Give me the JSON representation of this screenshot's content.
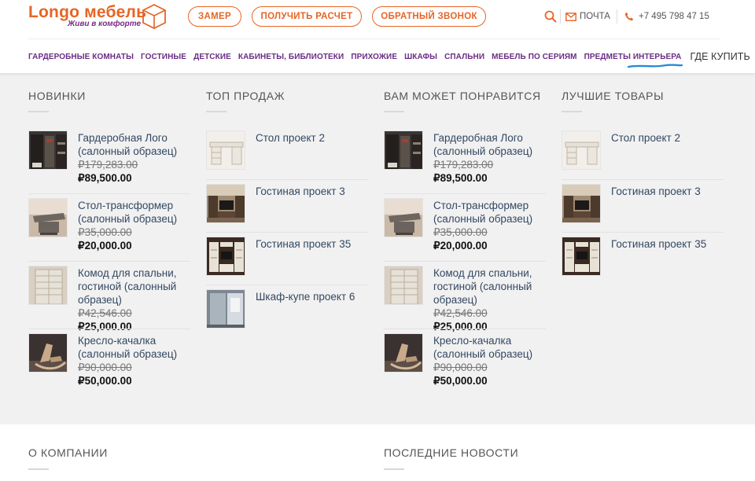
{
  "brand": {
    "name": "Longo мебель",
    "tagline": "Живи в комфорте",
    "accent_color": "#e86424",
    "secondary_color": "#7a2a85"
  },
  "header": {
    "buttons": [
      "ЗАМЕР",
      "ПОЛУЧИТЬ РАСЧЕТ",
      "ОБРАТНЫЙ ЗВОНОК"
    ],
    "mail_label": "ПОЧТА",
    "phone": "+7 495 798 47 15",
    "icons": [
      "search-icon",
      "mail-icon",
      "phone-icon"
    ]
  },
  "nav": {
    "items": [
      "ГАРДЕРОБНЫЕ КОМНАТЫ",
      "ГОСТИНЫЕ",
      "ДЕТСКИЕ",
      "КАБИНЕТЫ, БИБЛИОТЕКИ",
      "ПРИХОЖИЕ",
      "ШКАФЫ",
      "СПАЛЬНИ",
      "МЕБЕЛЬ ПО СЕРИЯМ",
      "ПРЕДМЕТЫ ИНТЕРЬЕРА"
    ],
    "active": "ГДЕ КУПИТЬ"
  },
  "columns": [
    {
      "title": "НОВИНКИ",
      "items": [
        {
          "name": "Гардеробная Лого (салонный образец)",
          "old": "₽179,283.00",
          "new": "₽89,500.00",
          "thumb": "wardrobe"
        },
        {
          "name": "Стол-трансформер (салонный образец)",
          "old": "₽35,000.00",
          "new": "₽20,000.00",
          "thumb": "table"
        },
        {
          "name": "Комод для спальни, гостиной (салонный образец)",
          "old": "₽42,546.00",
          "new": "₽25,000.00",
          "thumb": "dresser"
        },
        {
          "name": "Кресло-качалка (салонный образец)",
          "old": "₽90,000.00",
          "new": "₽50,000.00",
          "thumb": "rocker"
        }
      ]
    },
    {
      "title": "ТОП ПРОДАЖ",
      "items": [
        {
          "name": "Стол проект 2",
          "thumb": "desk"
        },
        {
          "name": "Гостиная проект 3",
          "thumb": "living3"
        },
        {
          "name": "Гостиная проект 35",
          "thumb": "living35"
        },
        {
          "name": "Шкаф-купе проект 6",
          "thumb": "closet"
        }
      ]
    },
    {
      "title": "ВАМ МОЖЕТ ПОНРАВИТСЯ",
      "items": [
        {
          "name": "Гардеробная Лого (салонный образец)",
          "old": "₽179,283.00",
          "new": "₽89,500.00",
          "thumb": "wardrobe"
        },
        {
          "name": "Стол-трансформер (салонный образец)",
          "old": "₽35,000.00",
          "new": "₽20,000.00",
          "thumb": "table"
        },
        {
          "name": "Комод для спальни, гостиной (салонный образец)",
          "old": "₽42,546.00",
          "new": "₽25,000.00",
          "thumb": "dresser"
        },
        {
          "name": "Кресло-качалка (салонный образец)",
          "old": "₽90,000.00",
          "new": "₽50,000.00",
          "thumb": "rocker"
        }
      ]
    },
    {
      "title": "ЛУЧШИЕ ТОВАРЫ",
      "items": [
        {
          "name": "Стол проект 2",
          "thumb": "desk"
        },
        {
          "name": "Гостиная проект 3",
          "thumb": "living3"
        },
        {
          "name": "Гостиная проект 35",
          "thumb": "living35"
        }
      ]
    }
  ],
  "footer": {
    "about": "О КОМПАНИИ",
    "news": "ПОСЛЕДНИЕ НОВОСТИ"
  }
}
